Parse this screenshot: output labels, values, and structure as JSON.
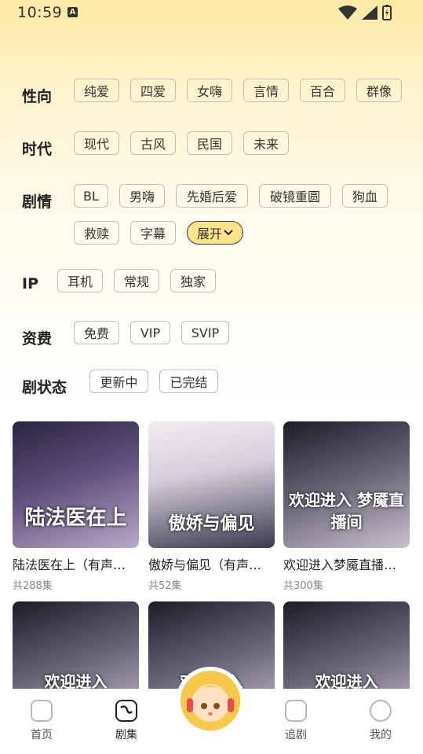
{
  "status_bar": {
    "time": "10:59",
    "notification_badge": "A"
  },
  "filters": {
    "orientation": {
      "label": "性向",
      "options": [
        "纯爱",
        "四爱",
        "女嗨",
        "言情",
        "百合",
        "群像"
      ]
    },
    "era": {
      "label": "时代",
      "options": [
        "现代",
        "古风",
        "民国",
        "未来"
      ]
    },
    "plot": {
      "label": "剧情",
      "options": [
        "BL",
        "男嗨",
        "先婚后爱",
        "破镜重圆",
        "狗血",
        "救赎",
        "字幕"
      ],
      "expand_label": "展开"
    },
    "ip": {
      "label": "IP",
      "options": [
        "耳机",
        "常规",
        "独家"
      ]
    },
    "fee": {
      "label": "资费",
      "options": [
        "免费",
        "VIP",
        "SVIP"
      ]
    },
    "status": {
      "label": "剧状态",
      "options": [
        "更新中",
        "已完结"
      ]
    }
  },
  "cards": [
    {
      "title": "陆法医在上（有声…",
      "count": "共288集",
      "cover_text": "陆法医在上"
    },
    {
      "title": "傲娇与偏见（有声…",
      "count": "共52集",
      "cover_text": "傲娇与偏见"
    },
    {
      "title": "欢迎进入梦魇直播…",
      "count": "共300集",
      "cover_text": "欢迎进入 梦魇直播间"
    },
    {
      "title": "",
      "count": "",
      "cover_text": "欢迎进入"
    },
    {
      "title": "",
      "count": "",
      "cover_text": "欢迎进入"
    },
    {
      "title": "",
      "count": "",
      "cover_text": "欢迎进入"
    }
  ],
  "tabs": {
    "home": "首页",
    "series": "剧集",
    "follow": "追剧",
    "mine": "我的"
  },
  "colors": {
    "accent": "#fde48a",
    "background_top": "#fde9a2"
  }
}
